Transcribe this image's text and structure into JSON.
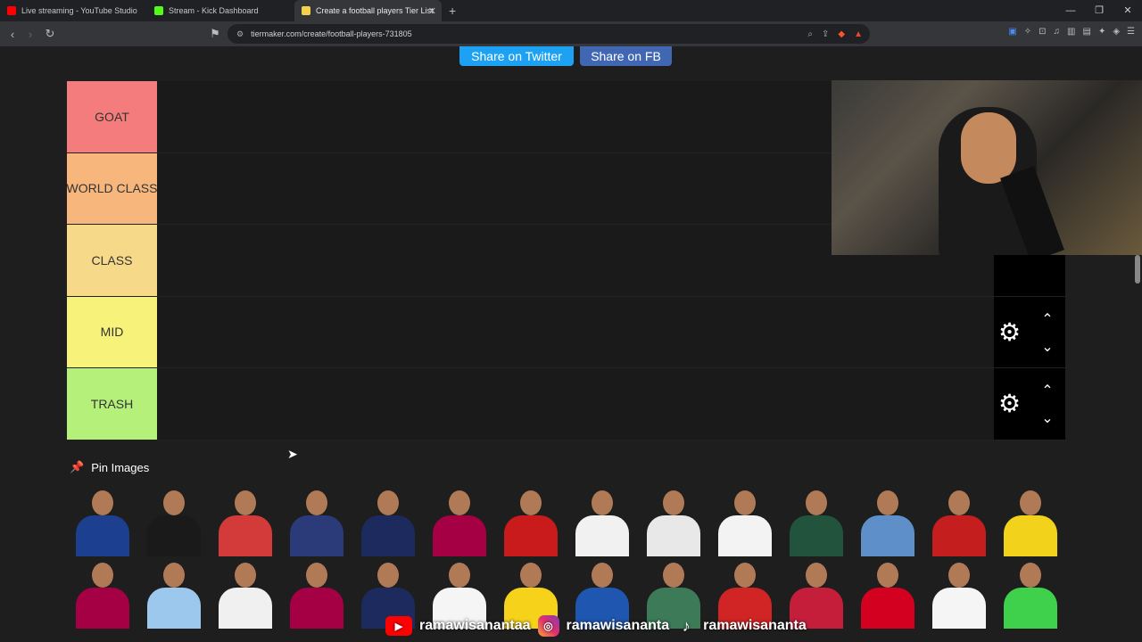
{
  "browser": {
    "tabs": [
      {
        "title": "Live streaming - YouTube Studio",
        "color": "#ff0000",
        "active": false
      },
      {
        "title": "Stream - Kick Dashboard",
        "color": "#53fc18",
        "active": false
      },
      {
        "title": "Create a football players Tier List",
        "color": "#f4d24b",
        "active": true
      }
    ],
    "new_tab": "+",
    "url": "tiermaker.com/create/football-players-731805"
  },
  "share": {
    "twitter": "Share on Twitter",
    "facebook": "Share on FB"
  },
  "tiers": [
    {
      "label": "GOAT",
      "color": "#f47c7c"
    },
    {
      "label": "WORLD CLASS",
      "color": "#f7b77c"
    },
    {
      "label": "CLASS",
      "color": "#f7d98a"
    },
    {
      "label": "MID",
      "color": "#f7f37a"
    },
    {
      "label": "TRASH",
      "color": "#b5f07a"
    }
  ],
  "pin_images": {
    "label": "Pin Images"
  },
  "gallery": {
    "rows": [
      [
        "#1d3f8f",
        "#1a1a1a",
        "#d33b3b",
        "#2b3a78",
        "#1d2a5e",
        "#a50044",
        "#c91b1b",
        "#f1f1f1",
        "#e8e8e8",
        "#f3f3f3",
        "#22543d",
        "#5f8fc9",
        "#c41e1e",
        "#f3d21b"
      ],
      [
        "#a50044",
        "#9bc8ec",
        "#f0f0f0",
        "#a50044",
        "#1d2a5e",
        "#f5f5f5",
        "#f7d21b",
        "#1e56b0",
        "#3c7a58",
        "#d12525",
        "#c41e3a",
        "#d4001f",
        "#f5f5f5",
        "#3fd14b"
      ]
    ]
  },
  "social": {
    "youtube": "ramawisanantaa",
    "instagram": "ramawisananta",
    "tiktok": "ramawisananta"
  }
}
